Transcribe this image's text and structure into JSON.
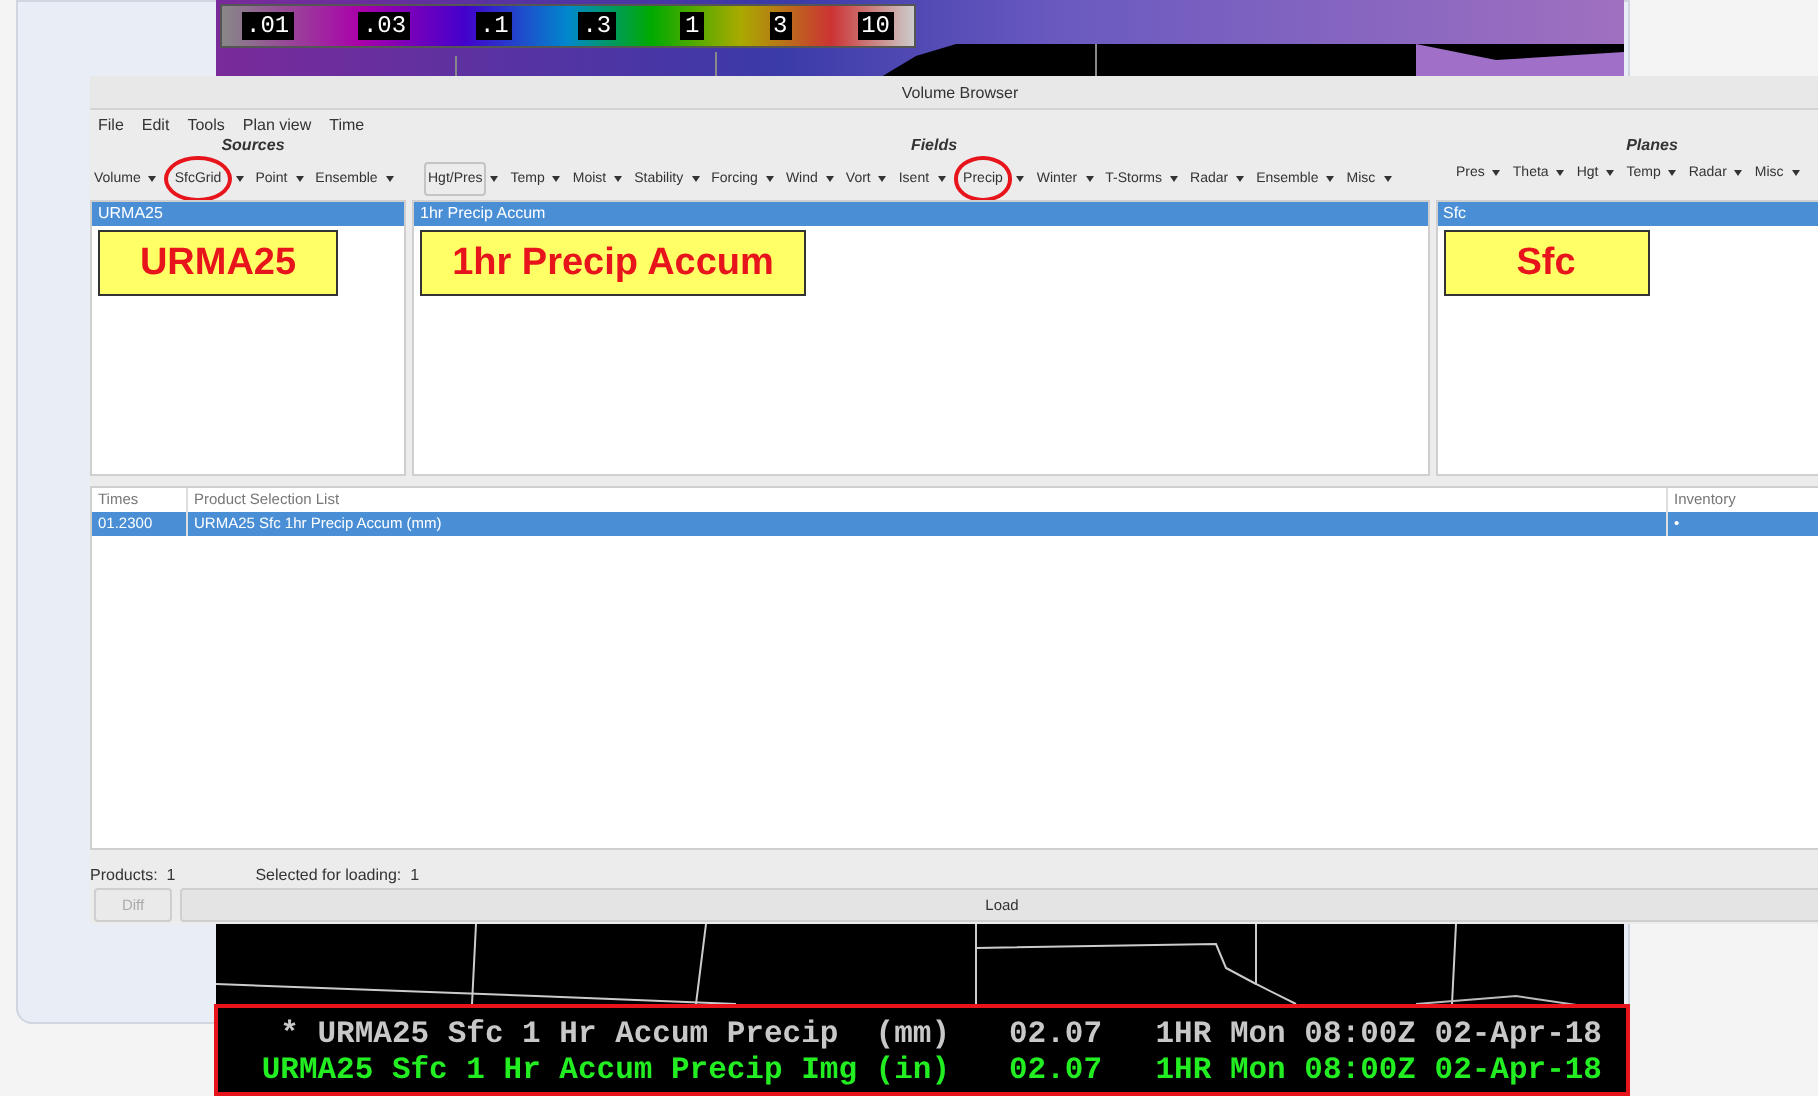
{
  "colorbar": {
    "labels": [
      ".01",
      ".03",
      ".1",
      ".3",
      "1",
      "3",
      "10"
    ]
  },
  "window": {
    "title": "Volume Browser"
  },
  "menu": [
    "File",
    "Edit",
    "Tools",
    "Plan view",
    "Time"
  ],
  "toolbar": [
    {
      "heading": "Sources",
      "items": [
        {
          "label": "Volume",
          "circled": false,
          "focused": false
        },
        {
          "label": "SfcGrid",
          "circled": true,
          "focused": false
        },
        {
          "label": "Point",
          "circled": false,
          "focused": false
        },
        {
          "label": "Ensemble",
          "circled": false,
          "focused": false
        }
      ]
    },
    {
      "heading": "Fields",
      "items": [
        {
          "label": "Hgt/Pres",
          "circled": false,
          "focused": true
        },
        {
          "label": "Temp",
          "circled": false,
          "focused": false
        },
        {
          "label": "Moist",
          "circled": false,
          "focused": false
        },
        {
          "label": "Stability",
          "circled": false,
          "focused": false
        },
        {
          "label": "Forcing",
          "circled": false,
          "focused": false
        },
        {
          "label": "Wind",
          "circled": false,
          "focused": false
        },
        {
          "label": "Vort",
          "circled": false,
          "focused": false
        },
        {
          "label": "Isent",
          "circled": false,
          "focused": false
        },
        {
          "label": "Precip",
          "circled": true,
          "focused": false
        },
        {
          "label": "Winter",
          "circled": false,
          "focused": false
        },
        {
          "label": "T-Storms",
          "circled": false,
          "focused": false
        },
        {
          "label": "Radar",
          "circled": false,
          "focused": false
        },
        {
          "label": "Ensemble",
          "circled": false,
          "focused": false
        },
        {
          "label": "Misc",
          "circled": false,
          "focused": false
        }
      ]
    },
    {
      "heading": "Planes",
      "items": [
        {
          "label": "Pres",
          "circled": false,
          "focused": false
        },
        {
          "label": "Theta",
          "circled": false,
          "focused": false
        },
        {
          "label": "Hgt",
          "circled": false,
          "focused": false
        },
        {
          "label": "Temp",
          "circled": false,
          "focused": false
        },
        {
          "label": "Radar",
          "circled": false,
          "focused": false
        },
        {
          "label": "Misc",
          "circled": false,
          "focused": false
        }
      ]
    }
  ],
  "panes": [
    {
      "items": [
        {
          "label": "URMA25",
          "selected": true
        }
      ],
      "callout": "URMA25"
    },
    {
      "items": [
        {
          "label": "1hr Precip Accum",
          "selected": true
        }
      ],
      "callout": "1hr Precip Accum"
    },
    {
      "items": [
        {
          "label": "Sfc",
          "selected": true
        }
      ],
      "callout": "Sfc"
    }
  ],
  "table": {
    "columns": [
      "Times",
      "Product Selection List",
      "Inventory"
    ],
    "rows": [
      {
        "cells": [
          "01.2300",
          "URMA25 Sfc 1hr Precip Accum (mm)",
          "•"
        ],
        "selected": true
      }
    ]
  },
  "status": [
    {
      "label": "Products:",
      "value": "1"
    },
    {
      "label": "Selected for loading:",
      "value": "1"
    }
  ],
  "buttons": [
    {
      "label": "Diff",
      "disabled": true
    },
    {
      "label": "Load",
      "disabled": false
    }
  ],
  "legend": [
    {
      "text": "* URMA25 Sfc 1 Hr Accum Precip  (mm)",
      "value": "02.07",
      "time": "1HR Mon 08:00Z 02-Apr-18",
      "color": "#c8c8c8"
    },
    {
      "text": "URMA25 Sfc 1 Hr Accum Precip Img (in)",
      "value": "02.07",
      "time": "1HR Mon 08:00Z 02-Apr-18",
      "color": "#22ee22"
    }
  ]
}
